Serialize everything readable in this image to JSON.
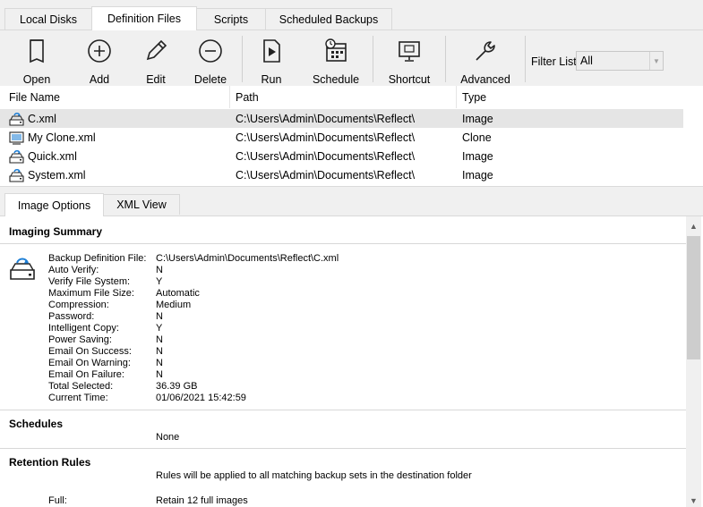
{
  "top_tabs": [
    {
      "label": "Local Disks"
    },
    {
      "label": "Definition Files"
    },
    {
      "label": "Scripts"
    },
    {
      "label": "Scheduled Backups"
    }
  ],
  "toolbar": {
    "open": "Open",
    "add": "Add",
    "edit": "Edit",
    "delete": "Delete",
    "run": "Run",
    "schedule": "Schedule",
    "shortcut": "Shortcut",
    "advanced": "Advanced",
    "filter_label": "Filter List",
    "filter_value": "All"
  },
  "file_list": {
    "columns": [
      "File Name",
      "Path",
      "Type"
    ],
    "rows": [
      {
        "name": "C.xml",
        "path": "C:\\Users\\Admin\\Documents\\Reflect\\",
        "type": "Image"
      },
      {
        "name": "My Clone.xml",
        "path": "C:\\Users\\Admin\\Documents\\Reflect\\",
        "type": "Clone"
      },
      {
        "name": "Quick.xml",
        "path": "C:\\Users\\Admin\\Documents\\Reflect\\",
        "type": "Image"
      },
      {
        "name": "System.xml",
        "path": "C:\\Users\\Admin\\Documents\\Reflect\\",
        "type": "Image"
      }
    ]
  },
  "bottom_tabs": [
    {
      "label": "Image Options"
    },
    {
      "label": "XML View"
    }
  ],
  "imaging_summary": {
    "title": "Imaging Summary",
    "rows": [
      {
        "label": "Backup Definition File:",
        "value": "C:\\Users\\Admin\\Documents\\Reflect\\C.xml"
      },
      {
        "label": "Auto Verify:",
        "value": "N"
      },
      {
        "label": "Verify File System:",
        "value": "Y"
      },
      {
        "label": "Maximum File Size:",
        "value": "Automatic"
      },
      {
        "label": "Compression:",
        "value": "Medium"
      },
      {
        "label": "Password:",
        "value": "N"
      },
      {
        "label": "Intelligent Copy:",
        "value": "Y"
      },
      {
        "label": "Power Saving:",
        "value": "N"
      },
      {
        "label": "Email On Success:",
        "value": "N"
      },
      {
        "label": "Email On Warning:",
        "value": "N"
      },
      {
        "label": "Email On Failure:",
        "value": "N"
      },
      {
        "label": "Total Selected:",
        "value": "36.39 GB"
      },
      {
        "label": "Current Time:",
        "value": "01/06/2021 15:42:59"
      }
    ]
  },
  "schedules": {
    "title": "Schedules",
    "value": "None"
  },
  "retention": {
    "title": "Retention Rules",
    "note": "Rules will be applied to all matching backup sets in the destination folder",
    "full_label": "Full:",
    "full_value": "Retain 12 full images"
  }
}
